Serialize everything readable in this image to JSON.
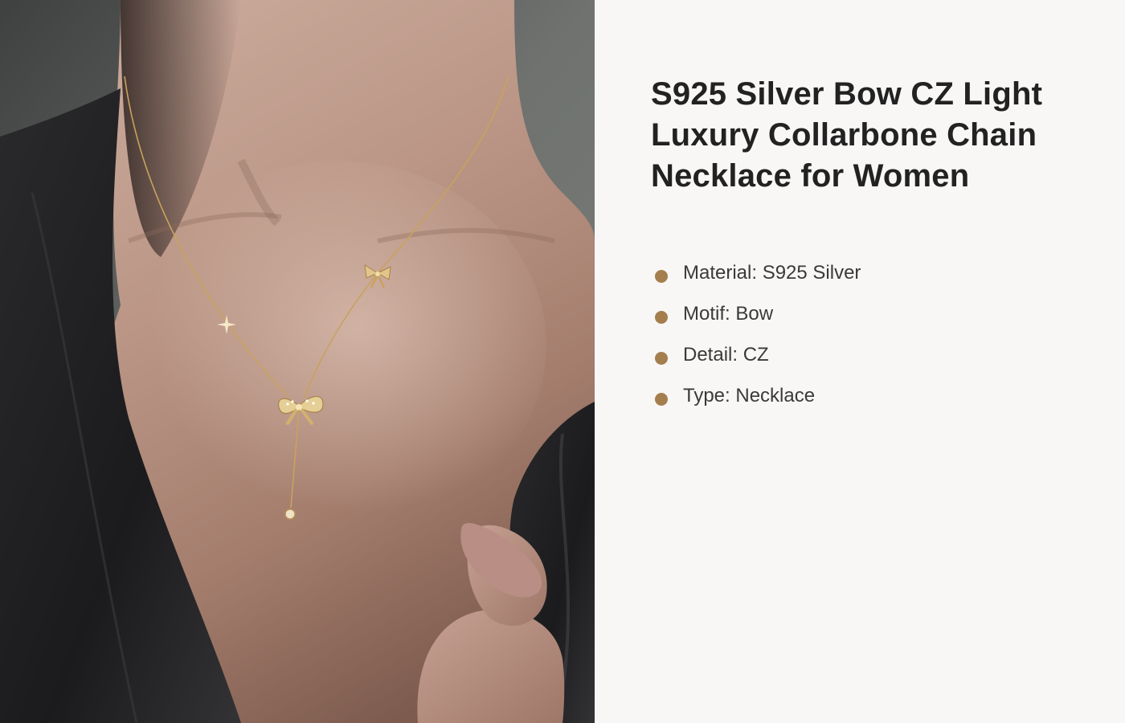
{
  "product": {
    "title": "S925 Silver Bow CZ Light Luxury Collarbone Chain Necklace for Women",
    "photo_description": "model-wearing-bow-necklace",
    "accent_color": "#a57e4e",
    "specs": [
      {
        "label": "Material: S925 Silver"
      },
      {
        "label": "Motif: Bow"
      },
      {
        "label": "Detail: CZ"
      },
      {
        "label": "Type: Necklace"
      }
    ]
  }
}
